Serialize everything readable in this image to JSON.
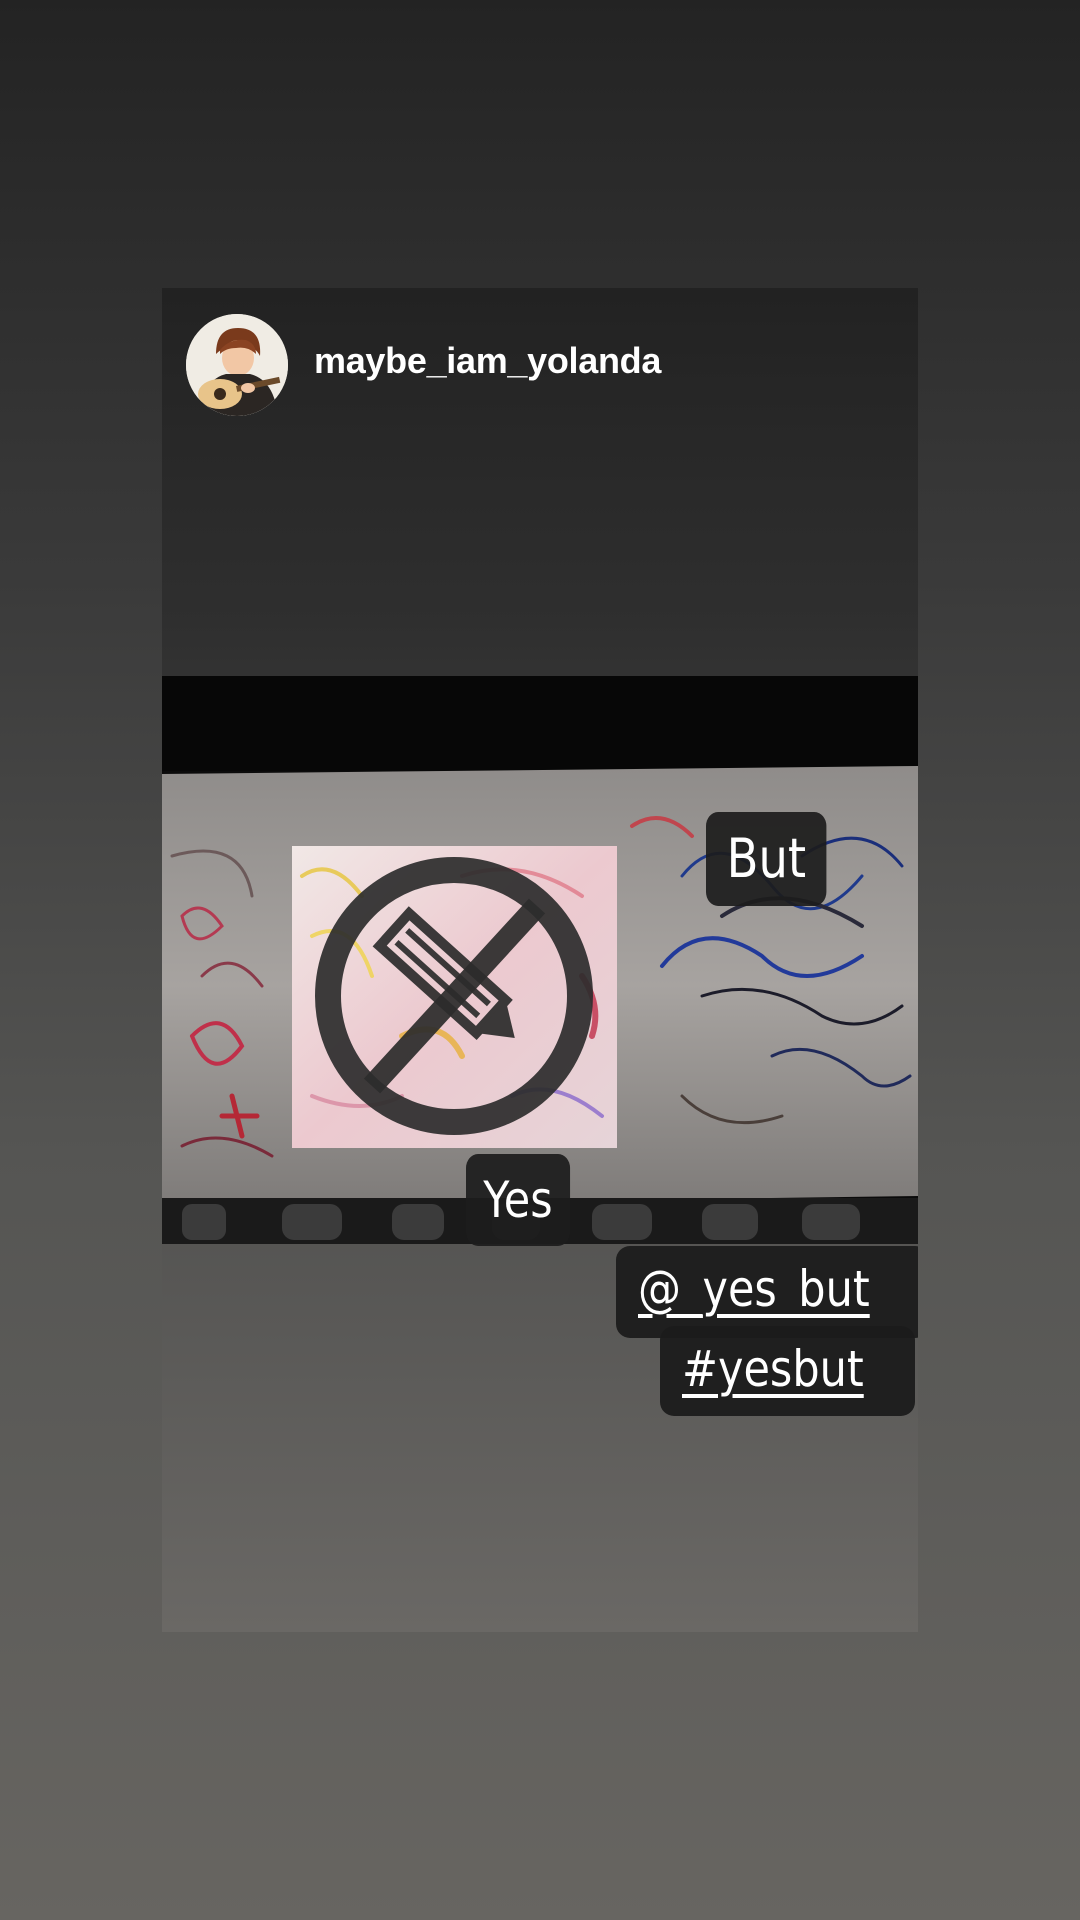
{
  "story": {
    "username": "maybe_iam_yolanda",
    "avatar_icon": "guitarist-avatar-icon"
  },
  "photo": {
    "subject": "no-pencil-sign-icon",
    "colors": {
      "sign_ring": "#2c2c2c",
      "sticker_bg": "#1c1c1c",
      "text": "#ffffff"
    }
  },
  "stickers": {
    "but": "But",
    "yes": "Yes",
    "mention": "@_yes_but",
    "hashtag": "#yesbut"
  }
}
